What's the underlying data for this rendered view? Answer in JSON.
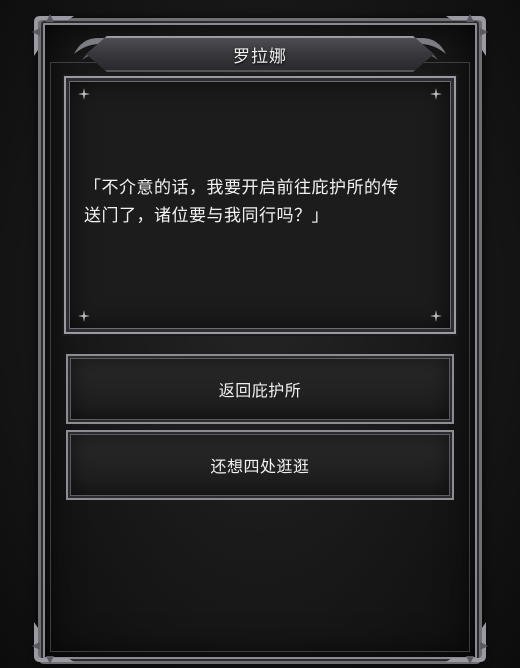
{
  "dialog": {
    "speaker": "罗拉娜",
    "text_line1": "「不介意的话，我要开启前往庇护所的传",
    "text_line2": "送门了，诸位要与我同行吗？」"
  },
  "options": [
    {
      "label": "返回庇护所"
    },
    {
      "label": "还想四处逛逛"
    }
  ]
}
